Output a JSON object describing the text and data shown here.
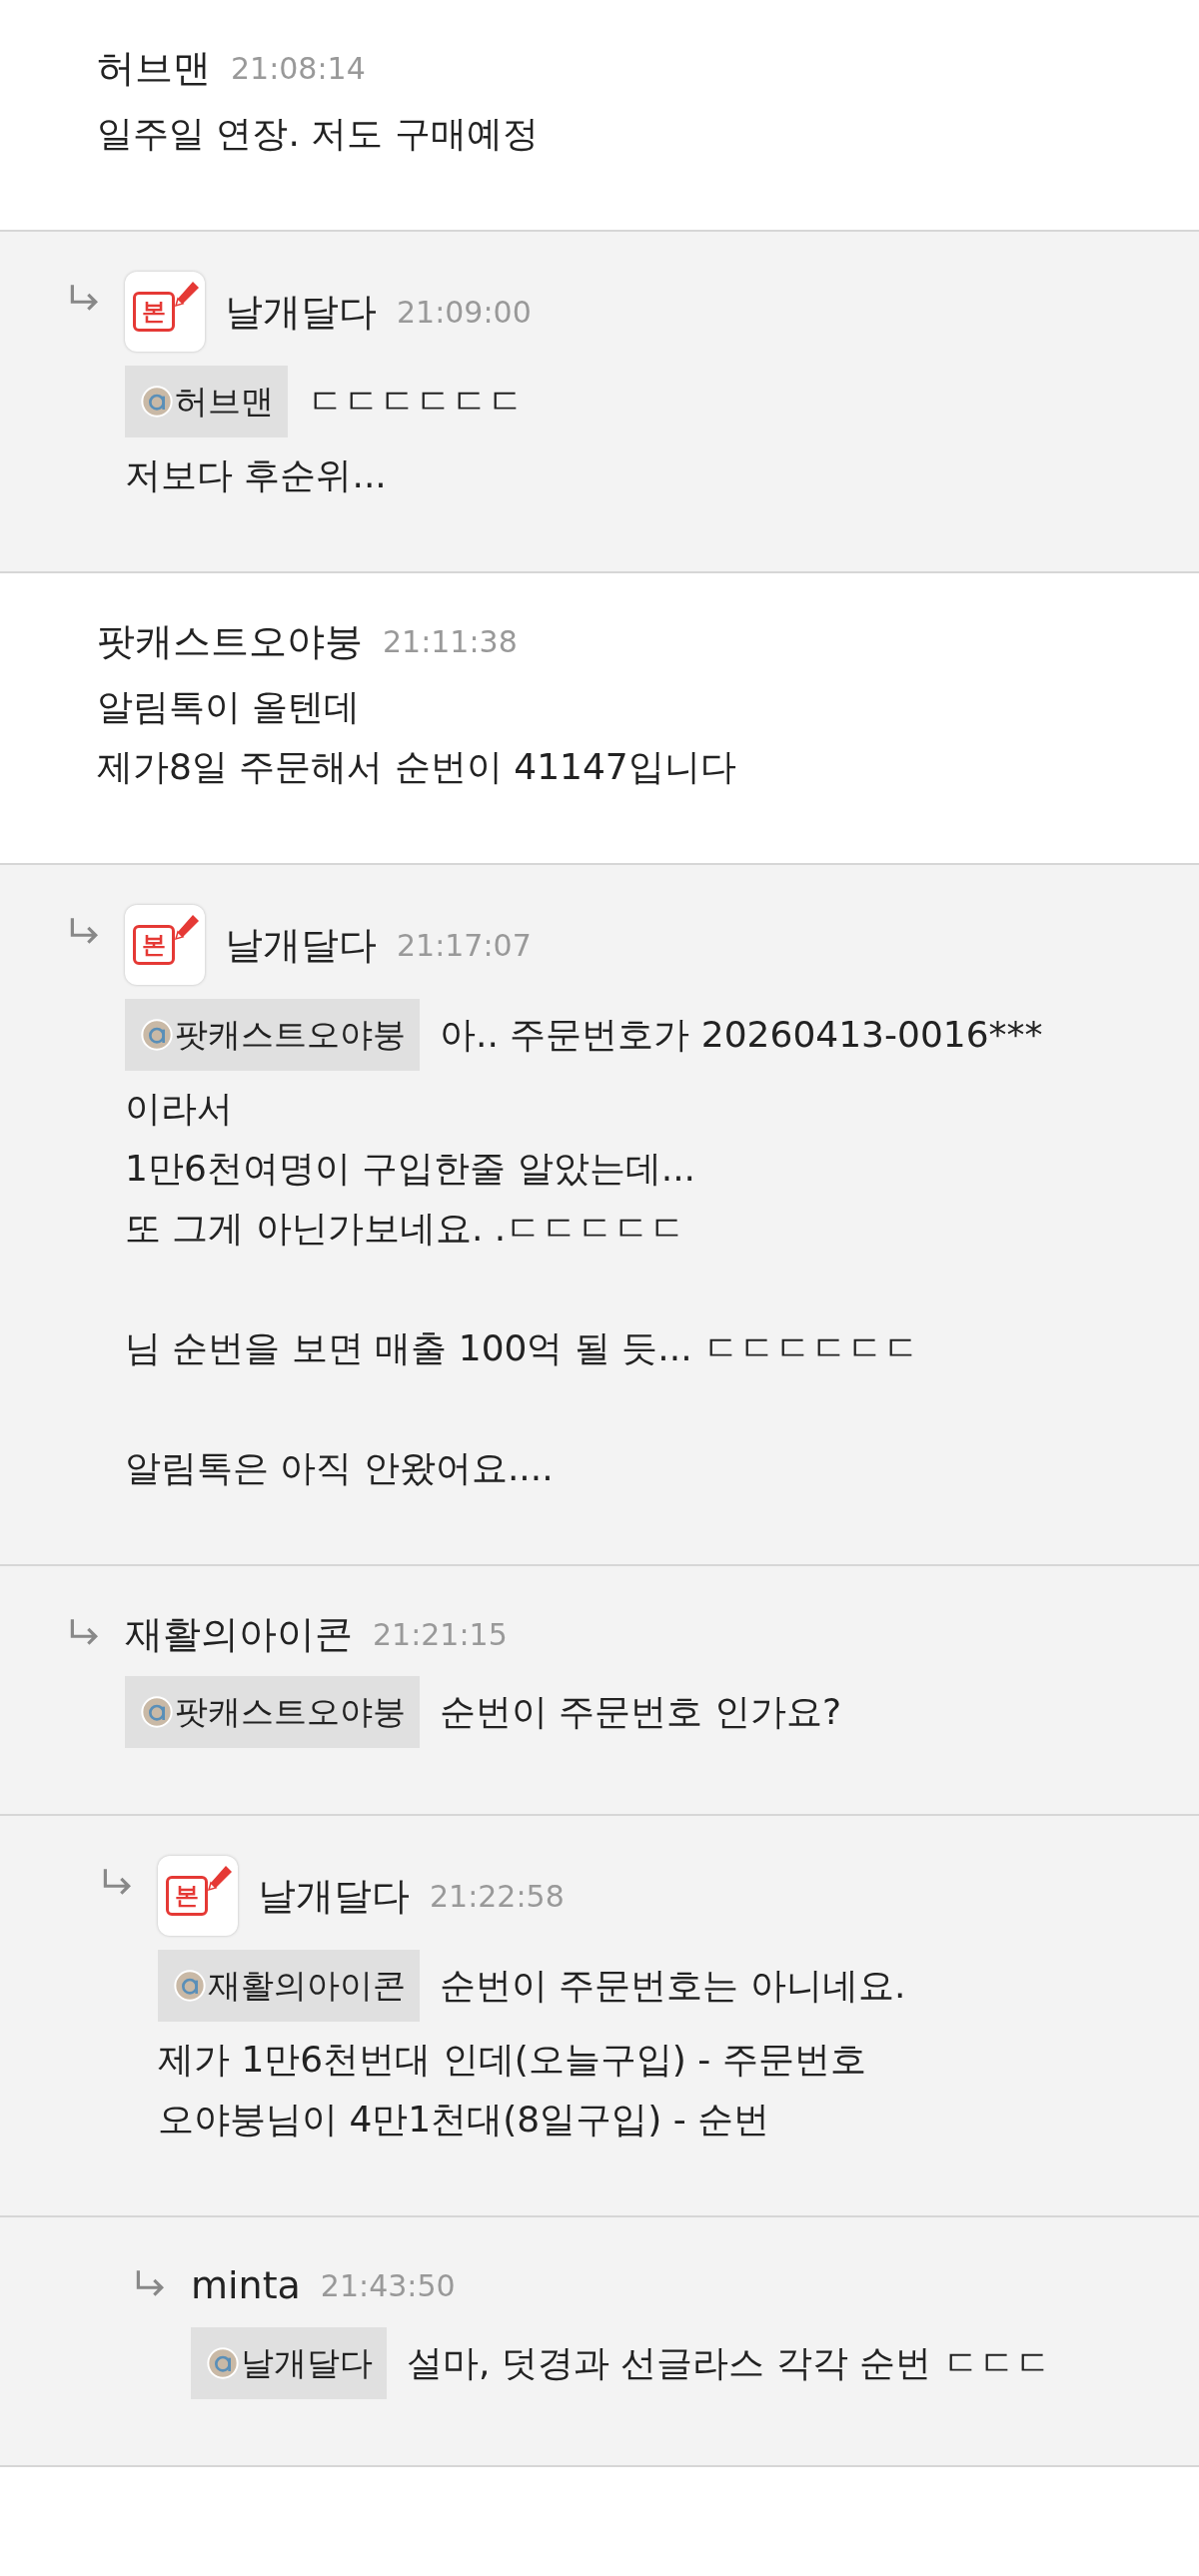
{
  "comments": [
    {
      "author": "허브맨",
      "time": "21:08:14",
      "body": "일주일 연장. 저도 구매예정",
      "children": [
        {
          "author": "날개달다",
          "time": "21:09:00",
          "badge": "본",
          "mention": "허브맨",
          "first_line": "ㄷㄷㄷㄷㄷㄷ",
          "body": "저보다 후순위..."
        }
      ]
    },
    {
      "author": "팟캐스트오야붕",
      "time": "21:11:38",
      "body": "알림톡이 올텐데\n제가8일 주문해서 순번이 41147입니다",
      "children": [
        {
          "author": "날개달다",
          "time": "21:17:07",
          "badge": "본",
          "mention": "팟캐스트오야붕",
          "first_line": "아.. 주문번호가 20260413-0016***",
          "body": "이라서\n1만6천여명이 구입한줄 알았는데...\n또 그게 아닌가보네요. .ㄷㄷㄷㄷㄷ\n\n님 순번을 보면 매출 100억 될 듯... ㄷㄷㄷㄷㄷㄷ\n\n알림톡은 아직 안왔어요...."
        },
        {
          "author": "재활의아이콘",
          "time": "21:21:15",
          "mention": "팟캐스트오야붕",
          "first_line": "순번이 주문번호 인가요?",
          "children": [
            {
              "author": "날개달다",
              "time": "21:22:58",
              "badge": "본",
              "mention": "재활의아이콘",
              "first_line": "순번이 주문번호는 아니네요.",
              "body": "제가 1만6천번대 인데(오늘구입) - 주문번호\n오야붕님이 4만1천대(8일구입) - 순번",
              "children": [
                {
                  "author": "minta",
                  "time": "21:43:50",
                  "mention": "날개달다",
                  "first_line": "설마, 덧경과 선글라스 각각 순번 ㄷㄷㄷ"
                }
              ]
            }
          ]
        }
      ]
    }
  ]
}
